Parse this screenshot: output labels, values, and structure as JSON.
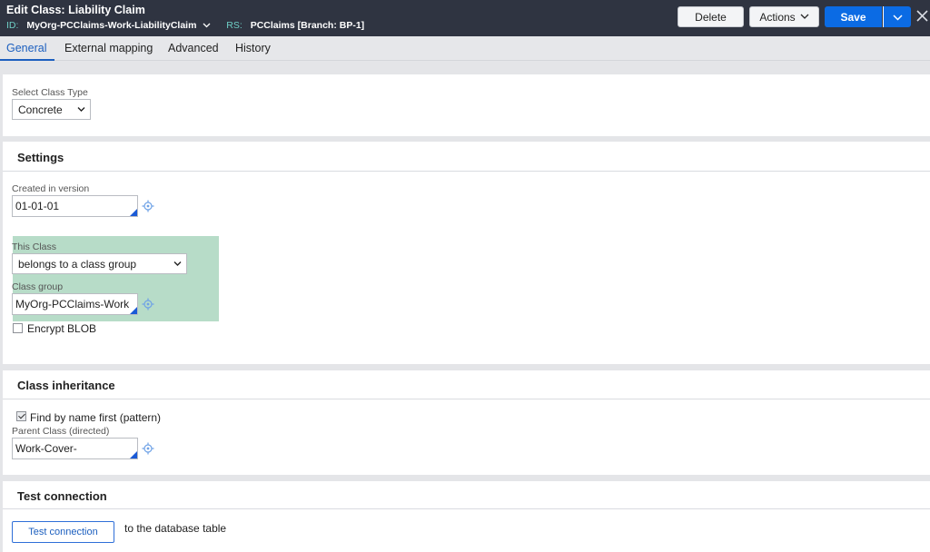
{
  "header": {
    "title": "Edit  Class: Liability Claim",
    "id_label": "ID:",
    "id_value": "MyOrg-PCClaims-Work-LiabilityClaim",
    "rs_label": "RS:",
    "rs_value": "PCClaims [Branch: BP-1]",
    "delete_label": "Delete",
    "actions_label": "Actions",
    "save_label": "Save",
    "icons": {
      "dropdown": "chevron-down-icon",
      "close": "close-icon"
    }
  },
  "tabs": [
    {
      "label": "General",
      "active": true
    },
    {
      "label": "External mapping",
      "active": false
    },
    {
      "label": "Advanced",
      "active": false
    },
    {
      "label": "History",
      "active": false
    }
  ],
  "class_type": {
    "label": "Select Class Type",
    "value": "Concrete"
  },
  "settings": {
    "title": "Settings",
    "created_in_version_label": "Created in version",
    "created_in_version_value": "01-01-01",
    "this_class_label": "This Class",
    "this_class_value": "belongs to a class group",
    "class_group_label": "Class group",
    "class_group_value": "MyOrg-PCClaims-Work",
    "encrypt_blob_label": "Encrypt BLOB",
    "encrypt_blob_checked": false
  },
  "inheritance": {
    "title": "Class inheritance",
    "find_by_name_label": "Find by name first (pattern)",
    "find_by_name_checked": true,
    "parent_class_label": "Parent Class (directed)",
    "parent_class_value": "Work-Cover-"
  },
  "test_connection": {
    "title": "Test connection",
    "button_label": "Test connection",
    "suffix_text": "to the database table"
  },
  "colors": {
    "header_bg": "#2f3441",
    "accent": "#0b6be4",
    "highlight": "#b7dcc8",
    "id_label": "#6fd0c7"
  }
}
